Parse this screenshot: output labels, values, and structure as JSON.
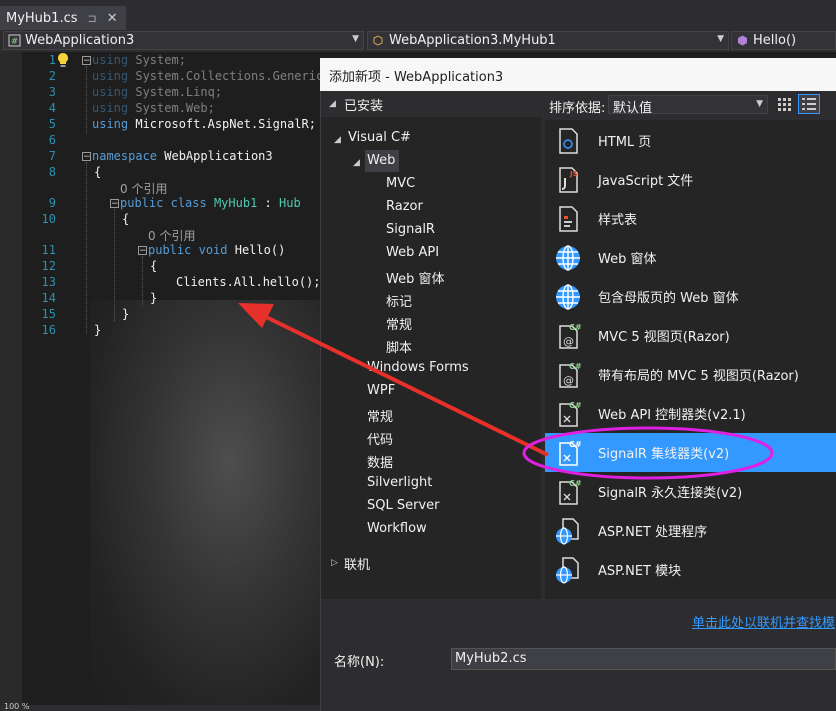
{
  "tab": {
    "title": "MyHub1.cs",
    "pin": "⊐",
    "close": "✕"
  },
  "navbar": {
    "project": "WebApplication3",
    "class": "WebApplication3.MyHub1",
    "member": "Hello()"
  },
  "editor": {
    "line_numbers": [
      "1",
      "2",
      "3",
      "4",
      "5",
      "6",
      "7",
      "8",
      "9",
      "10",
      "11",
      "12",
      "13",
      "14",
      "15",
      "16"
    ],
    "lines": {
      "l1_kw": "using",
      "l1_rest": " System;",
      "l2_kw": "using",
      "l2_rest": " System.Collections.Generic",
      "l3_kw": "using",
      "l3_rest": " System.Linq;",
      "l4_kw": "using",
      "l4_rest": " System.Web;",
      "l5_kw": "using",
      "l5_rest": " Microsoft.AspNet.SignalR;",
      "l7_kw": "namespace",
      "l7_rest": " WebApplication3",
      "l8": "{",
      "ref1": "0 个引用",
      "l9_kw1": "public",
      "l9_kw2": "class",
      "l9_type": "MyHub1",
      "l9_colon": " : ",
      "l9_base": "Hub",
      "l10": "{",
      "ref2": "0 个引用",
      "l11_kw1": "public",
      "l11_kw2": "void",
      "l11_rest": " Hello()",
      "l12": "{",
      "l13": "Clients.All.hello();",
      "l14": "}",
      "l15": "}",
      "l16": "}"
    },
    "zoom": "100 %"
  },
  "dialog": {
    "title": "添加新项 - WebApplication3",
    "installed": "已安装",
    "sort_label": "排序依据:",
    "sort_value": "默认值",
    "tree": {
      "visual_csharp": "Visual C#",
      "web": "Web",
      "web_children": [
        "MVC",
        "Razor",
        "SignalR",
        "Web API",
        "Web 窗体",
        "标记",
        "常规",
        "脚本"
      ],
      "others": [
        "Windows Forms",
        "WPF",
        "常规",
        "代码",
        "数据",
        "Silverlight",
        "SQL Server",
        "Workflow"
      ],
      "online": "联机"
    },
    "templates": [
      "HTML 页",
      "JavaScript 文件",
      "样式表",
      "Web 窗体",
      "包含母版页的 Web 窗体",
      "MVC 5 视图页(Razor)",
      "带有布局的 MVC 5 视图页(Razor)",
      "Web API 控制器类(v2.1)",
      "SignalR 集线器类(v2)",
      "SignalR 永久连接类(v2)",
      "ASP.NET 处理程序",
      "ASP.NET 模块"
    ],
    "selected_template": "SignalR 集线器类(v2)",
    "online_link": "单击此处以联机并查找模",
    "name_label": "名称(N):",
    "name_value": "MyHub2.cs"
  },
  "colors": {
    "accent": "#3399ff",
    "annotation_red": "#e8302a",
    "annotation_magenta": "#e020e0"
  }
}
